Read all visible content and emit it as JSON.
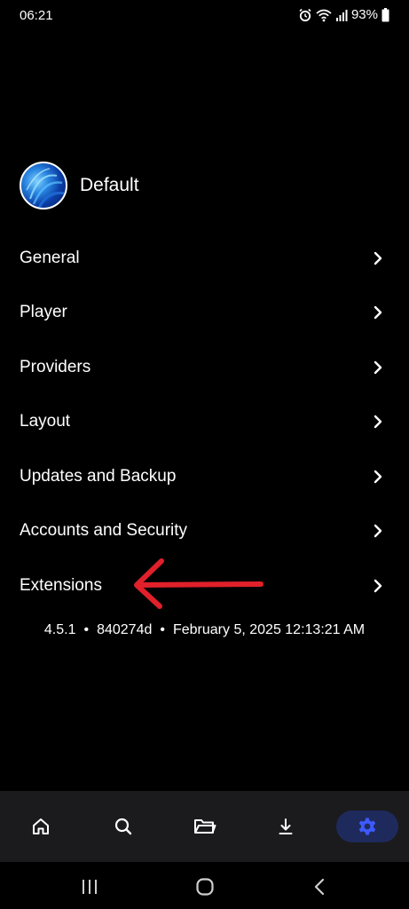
{
  "status_bar": {
    "time": "06:21",
    "battery_percent": "93%",
    "icons": [
      "alarm-icon",
      "wifi-icon",
      "signal-icon",
      "battery-icon"
    ]
  },
  "profile": {
    "name": "Default"
  },
  "menu": {
    "items": [
      {
        "label": "General"
      },
      {
        "label": "Player"
      },
      {
        "label": "Providers"
      },
      {
        "label": "Layout"
      },
      {
        "label": "Updates and Backup"
      },
      {
        "label": "Accounts and Security"
      },
      {
        "label": "Extensions"
      }
    ]
  },
  "version": {
    "number": "4.5.1",
    "commit": "840274d",
    "date": "February 5, 2025 12:13:21 AM"
  },
  "annotation": {
    "color": "#e0202a"
  },
  "bottom_nav": {
    "items": [
      "home-icon",
      "search-icon",
      "folder-icon",
      "download-icon",
      "settings-icon"
    ],
    "active": "settings-icon",
    "active_color": "#3d5afe"
  },
  "system_nav": {
    "items": [
      "recent-apps-icon",
      "home-circle-icon",
      "back-icon"
    ]
  }
}
